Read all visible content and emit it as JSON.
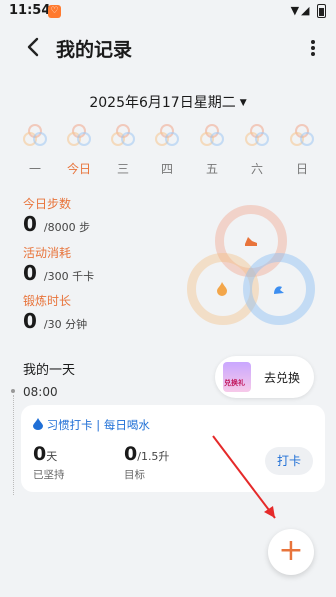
{
  "status_bar": {
    "time": "11:54",
    "notification_glyph": "♡",
    "signal": "▼◢"
  },
  "header": {
    "title": "我的记录"
  },
  "date_selector": {
    "label": "2025年6月17日星期二",
    "caret": "▼"
  },
  "week": [
    {
      "label": "一",
      "today": false
    },
    {
      "label": "今日",
      "today": true
    },
    {
      "label": "三",
      "today": false
    },
    {
      "label": "四",
      "today": false
    },
    {
      "label": "五",
      "today": false
    },
    {
      "label": "六",
      "today": false
    },
    {
      "label": "日",
      "today": false
    }
  ],
  "stats": {
    "steps": {
      "label": "今日步数",
      "value": "0",
      "unit": "/8000 步"
    },
    "calories": {
      "label": "活动消耗",
      "value": "0",
      "unit": "/300 千卡"
    },
    "exercise": {
      "label": "锻炼时长",
      "value": "0",
      "unit": "/30 分钟"
    }
  },
  "rings": {
    "colors": {
      "red": "#e8743b",
      "orange": "#f3a64a",
      "blue": "#3d8ef0"
    }
  },
  "my_day": {
    "heading": "我的一天",
    "time": "08:00"
  },
  "exchange": {
    "label": "去兑换",
    "gift_text": "兑换礼"
  },
  "habit_card": {
    "title": "习惯打卡 | 每日喝水",
    "days_value": "0",
    "days_unit": "天",
    "days_label": "已坚持",
    "target_value": "0",
    "target_unit": "/1.5升",
    "target_label": "目标",
    "punch_label": "打卡"
  },
  "fab": {
    "label": "+"
  }
}
